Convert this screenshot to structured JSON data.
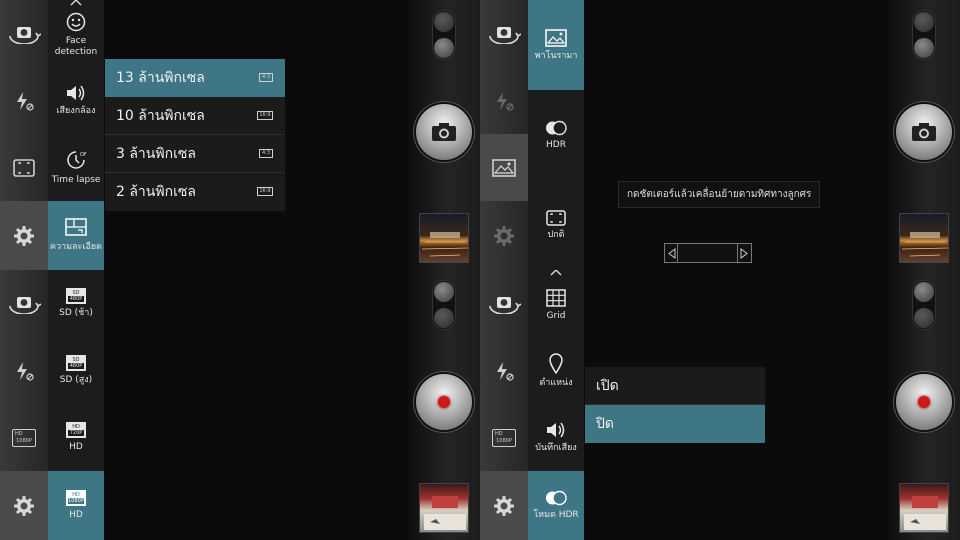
{
  "photo_menu": {
    "top_partial_label": "",
    "items": [
      {
        "label": "Face detection",
        "icon": "smiley-icon"
      },
      {
        "label": "เสียงกล้อง",
        "icon": "speaker-icon"
      },
      {
        "label": "Time lapse",
        "icon": "timelapse-icon"
      },
      {
        "label": "ความละเอียด",
        "icon": "resolution-icon",
        "selected": true
      }
    ],
    "resolution_options": [
      {
        "label": "13 ล้านพิกเซล",
        "ratio": "4:3",
        "selected": true
      },
      {
        "label": "10 ล้านพิกเซล",
        "ratio": "16:9"
      },
      {
        "label": "3 ล้านพิกเซล",
        "ratio": "4:3"
      },
      {
        "label": "2 ล้านพิกเซล",
        "ratio": "16:9"
      }
    ]
  },
  "video_menu": {
    "items": [
      {
        "label": "SD (ช้า)",
        "badge_top": "SD",
        "badge_bottom": "480P"
      },
      {
        "label": "SD (สูง)",
        "badge_top": "SD",
        "badge_bottom": "480P"
      },
      {
        "label": "HD",
        "badge_top": "HD",
        "badge_bottom": "720P"
      },
      {
        "label": "HD",
        "badge_top": "HD",
        "badge_bottom": "1080P",
        "selected": true
      }
    ],
    "side_badge_top": "HD",
    "side_badge_bottom": "1080P"
  },
  "mode_menu": {
    "items": [
      {
        "label": "พาโนรามา",
        "icon": "panorama-icon",
        "selected": true
      },
      {
        "label": "HDR",
        "icon": "hdr-icon"
      },
      {
        "label": "ปกติ",
        "icon": "normal-mode-icon"
      }
    ],
    "panorama_hint": "กดชัตเตอร์แล้วเคลื่อนย้ายตามทิศทางลูกศร"
  },
  "settings_menu": {
    "items": [
      {
        "label": "Grid",
        "icon": "grid-icon"
      },
      {
        "label": "ตำแหน่ง",
        "icon": "location-pin-icon"
      },
      {
        "label": "บันทึกเสียง",
        "icon": "speaker-icon"
      },
      {
        "label": "โหมด HDR",
        "icon": "hdr-icon",
        "selected": true
      }
    ],
    "toggle_options": [
      {
        "label": "เปิด"
      },
      {
        "label": "ปิด",
        "selected": true
      }
    ]
  },
  "colors": {
    "accent": "#3f7685",
    "panel": "#1c1c1c",
    "background": "#0b0b0b",
    "record_red": "#d01818"
  }
}
